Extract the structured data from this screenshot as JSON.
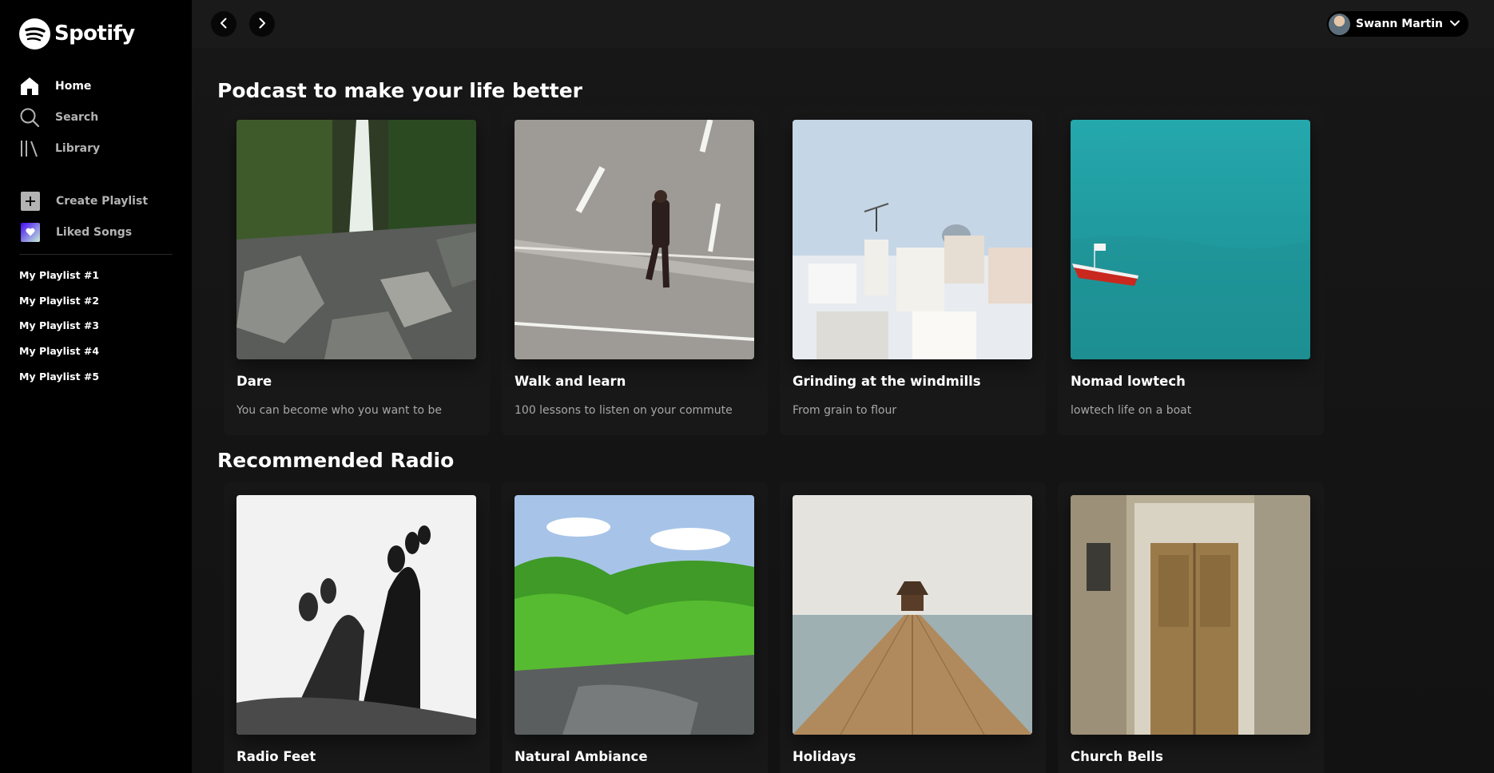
{
  "app": {
    "name": "Spotify"
  },
  "sidebar": {
    "nav": [
      {
        "label": "Home",
        "icon": "home-icon",
        "active": true
      },
      {
        "label": "Search",
        "icon": "search-icon",
        "active": false
      },
      {
        "label": "Library",
        "icon": "library-icon",
        "active": false
      }
    ],
    "create_playlist": "Create Playlist",
    "liked_songs": "Liked Songs",
    "playlists": [
      "My Playlist #1",
      "My Playlist #2",
      "My Playlist #3",
      "My Playlist #4",
      "My Playlist #5"
    ]
  },
  "topbar": {
    "user_name": "Swann Martin"
  },
  "sections": [
    {
      "title": "Podcast to make your life better",
      "cards": [
        {
          "title": "Dare",
          "subtitle": "You can become who you want to be",
          "image": "waterfall-rocks"
        },
        {
          "title": "Walk and learn",
          "subtitle": "100 lessons to listen on your commute",
          "image": "man-walking-street"
        },
        {
          "title": "Grinding at the windmills",
          "subtitle": "From grain to flour",
          "image": "santorini-windmills"
        },
        {
          "title": "Nomad lowtech",
          "subtitle": "lowtech life on a boat",
          "image": "red-boat-sea"
        }
      ]
    },
    {
      "title": "Recommended Radio",
      "cards": [
        {
          "title": "Radio Feet",
          "subtitle": "",
          "image": "feet-silhouette"
        },
        {
          "title": "Natural Ambiance",
          "subtitle": "",
          "image": "forest-river"
        },
        {
          "title": "Holidays",
          "subtitle": "",
          "image": "wooden-pier"
        },
        {
          "title": "Church Bells",
          "subtitle": "",
          "image": "wooden-door"
        }
      ]
    }
  ],
  "colors": {
    "sidebar_bg": "#000000",
    "main_bg": "#121212",
    "card_bg": "#181818",
    "accent": "#1db954"
  }
}
